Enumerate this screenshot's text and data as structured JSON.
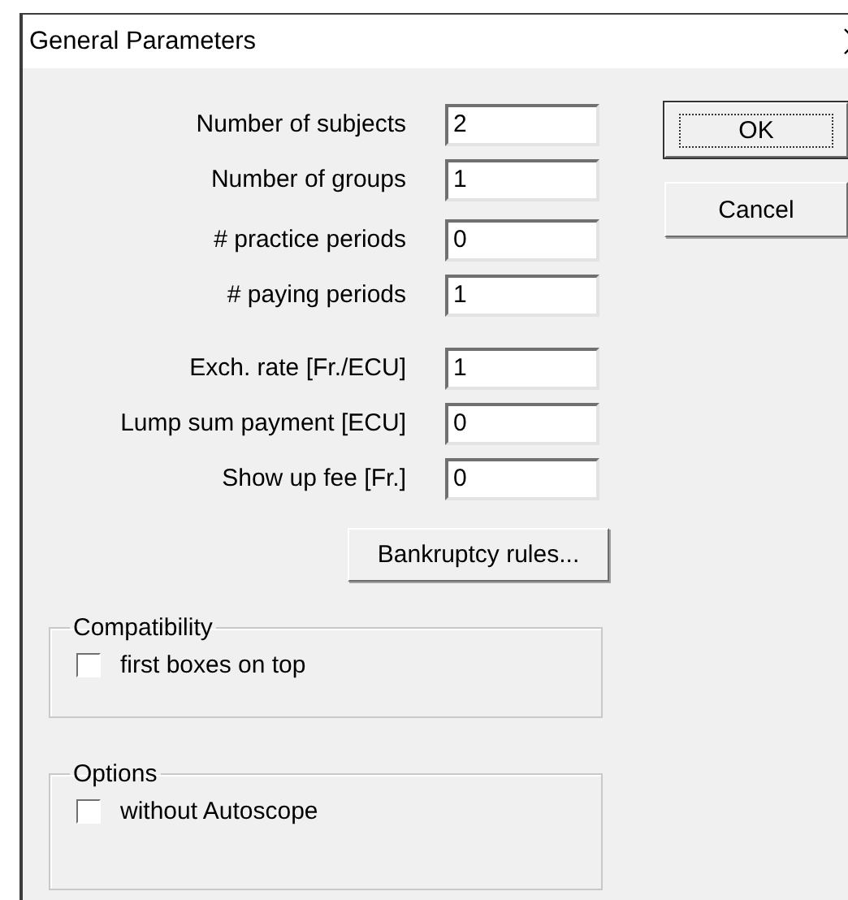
{
  "window": {
    "title": "General Parameters"
  },
  "field_sections": [
    {
      "fields": [
        {
          "label": "Number of subjects",
          "value": "2"
        },
        {
          "label": "Number of groups",
          "value": "1"
        }
      ]
    },
    {
      "fields": [
        {
          "label": "# practice periods",
          "value": "0"
        },
        {
          "label": "# paying periods",
          "value": "1"
        }
      ]
    },
    {
      "fields": [
        {
          "label": "Exch. rate [Fr./ECU]",
          "value": "1"
        },
        {
          "label": "Lump sum payment [ECU]",
          "value": "0"
        },
        {
          "label": "Show up fee [Fr.]",
          "value": "0"
        }
      ]
    }
  ],
  "bankruptcy_button": "Bankruptcy rules...",
  "groups": [
    {
      "title": "Compatibility",
      "options": [
        {
          "label": "first boxes on top",
          "checked": false
        }
      ]
    },
    {
      "title": "Options",
      "options": [
        {
          "label": "without Autoscope",
          "checked": false
        }
      ]
    }
  ],
  "buttons": [
    {
      "label": "OK",
      "default": true
    },
    {
      "label": "Cancel",
      "default": false
    }
  ]
}
